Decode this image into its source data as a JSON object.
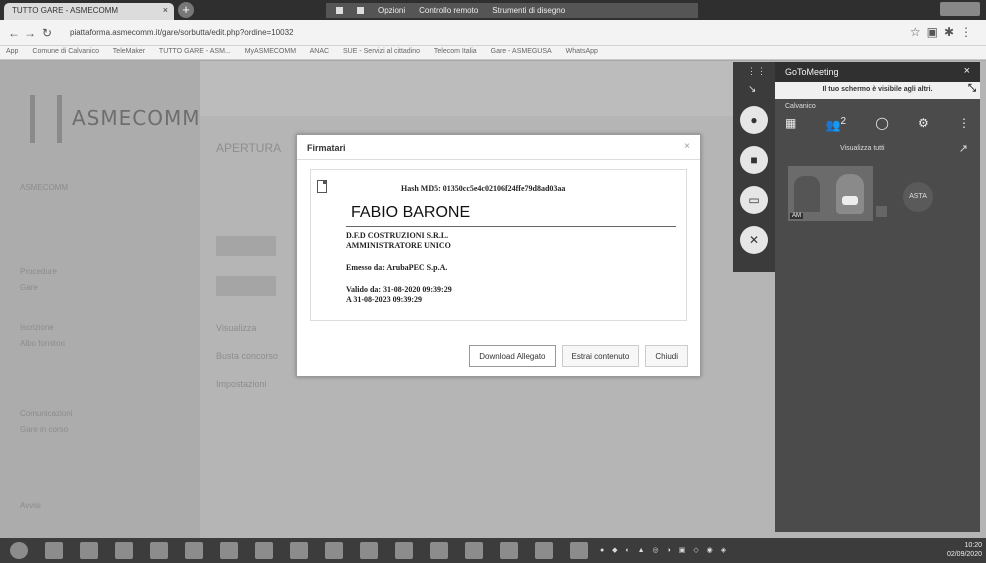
{
  "browser": {
    "tab_title": "TUTTO GARE - ASMECOMM",
    "tab_close": "×",
    "new_tab": "+",
    "url": "piattaforma.asmecomm.it/gare/sorbutta/edit.php?ordine=10032",
    "bookmarks": [
      "App",
      "Comune di Calvanico",
      "TeleMaker",
      "TUTTO GARE - ASM...",
      "MyASMECOMM",
      "ANAC",
      "SUE - Servizi al cittadino",
      "Telecom Italia",
      "Gare - ASMEGUSA",
      "WhatsApp"
    ]
  },
  "share_controls": {
    "options_label": "Opzioni",
    "remote_label": "Controllo remoto",
    "draw_label": "Strumenti di disegno"
  },
  "page": {
    "logo_text": "ASMECOMM",
    "ghost_title": "APERTURA",
    "sidebar_items": [
      "ASMECOMM",
      "Procedure",
      "Gare",
      "Iscrizione",
      "Albo fornitori",
      "Comunicazioni",
      "Gare in corso",
      "Avvisi"
    ],
    "ghost_lines": [
      "Visualizza",
      "Busta concorso",
      "Impostazioni"
    ]
  },
  "modal": {
    "title": "Firmatari",
    "close": "×",
    "hash": "Hash MD5: 01350cc5e4c02106f24ffe79d8ad03aa",
    "signer_name": "FABIO BARONE",
    "company": "D.F.D COSTRUZIONI S.R.L.",
    "role": "AMMINISTRATORE UNICO",
    "issuer": "Emesso da: ArubaPEC S.p.A.",
    "valid_from": "Valido da: 31-08-2020 09:39:29",
    "valid_to": "A 31-08-2023 09:39:29",
    "btn_download": "Download Allegato",
    "btn_extract": "Estrai contenuto",
    "btn_close": "Chiudi"
  },
  "gotomeeting": {
    "title": "GoToMeeting",
    "close": "×",
    "banner": "Il tuo schermo è visibile agli altri.",
    "room": "Calvanico",
    "participants_count": "2",
    "view_all": "Visualizza tutti",
    "video_label": "AM",
    "attendee_tag": "ASTA"
  },
  "taskbar": {
    "time": "10:20",
    "date": "02/09/2020"
  }
}
